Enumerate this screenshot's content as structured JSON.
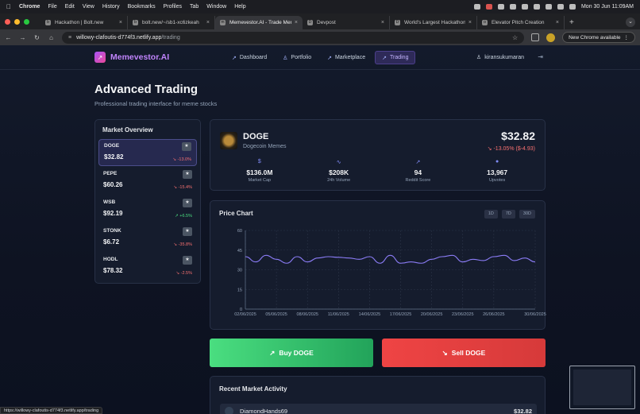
{
  "menubar": {
    "app": "Chrome",
    "items": [
      "File",
      "Edit",
      "View",
      "History",
      "Bookmarks",
      "Profiles",
      "Tab",
      "Window",
      "Help"
    ],
    "clock": "Mon 30 Jun  11:09AM"
  },
  "tabs": [
    {
      "title": "Hackathon | Bolt.new",
      "favicon": "b"
    },
    {
      "title": "bolt.new/~/sb1-xc6zkeah",
      "favicon": "b"
    },
    {
      "title": "Memevestor.AI - Trade Meme",
      "favicon": "m"
    },
    {
      "title": "Devpost",
      "favicon": "D"
    },
    {
      "title": "World's Largest Hackathon p",
      "favicon": "D"
    },
    {
      "title": "Elevator Pitch Creation",
      "favicon": "o"
    }
  ],
  "address": {
    "host": "willowy-clafoutis-d774f3.netlify.app",
    "path": "/trading",
    "update_label": "New Chrome available"
  },
  "app": {
    "logo": "Memevestor.AI",
    "nav": [
      {
        "label": "Dashboard",
        "icon": "trend-icon"
      },
      {
        "label": "Portfolio",
        "icon": "user-icon"
      },
      {
        "label": "Marketplace",
        "icon": "trend-icon"
      },
      {
        "label": "Trading",
        "icon": "trend-icon"
      }
    ],
    "active_nav": "Trading",
    "username": "kiransukumaran"
  },
  "page": {
    "title": "Advanced Trading",
    "subtitle": "Professional trading interface for meme stocks"
  },
  "market_overview": {
    "title": "Market Overview",
    "items": [
      {
        "symbol": "DOGE",
        "price": "$32.82",
        "change": "-13.0%",
        "direction": "down",
        "selected": true
      },
      {
        "symbol": "PEPE",
        "price": "$60.26",
        "change": "-15.4%",
        "direction": "down",
        "selected": false
      },
      {
        "symbol": "WSB",
        "price": "$92.19",
        "change": "+6.5%",
        "direction": "up",
        "selected": false
      },
      {
        "symbol": "STONK",
        "price": "$6.72",
        "change": "-35.8%",
        "direction": "down",
        "selected": false
      },
      {
        "symbol": "HODL",
        "price": "$78.32",
        "change": "-2.5%",
        "direction": "down",
        "selected": false
      }
    ]
  },
  "stock": {
    "symbol": "DOGE",
    "name": "Dogecoin Memes",
    "price": "$32.82",
    "change": "-13.05% ($-4.93)",
    "stats": [
      {
        "value": "$136.0M",
        "label": "Market Cap",
        "icon": "dollar-icon"
      },
      {
        "value": "$208K",
        "label": "24h Volume",
        "icon": "pulse-icon"
      },
      {
        "value": "94",
        "label": "Reddit Score",
        "icon": "trend-icon"
      },
      {
        "value": "13,967",
        "label": "Upvotes",
        "icon": "dot-icon"
      }
    ]
  },
  "chart": {
    "ranges": [
      "1D",
      "7D",
      "30D"
    ]
  },
  "chart_data": {
    "type": "line",
    "title": "Price Chart",
    "xlabel": "",
    "ylabel": "",
    "ylim": [
      0,
      60
    ],
    "yticks": [
      0,
      15,
      30,
      45,
      60
    ],
    "xticks": [
      "02/06/2025",
      "05/06/2025",
      "08/06/2025",
      "11/06/2025",
      "14/06/2025",
      "17/06/2025",
      "20/06/2025",
      "23/06/2025",
      "26/06/2025",
      "30/06/2025"
    ],
    "x": [
      "02/06/2025",
      "03/06/2025",
      "04/06/2025",
      "05/06/2025",
      "06/06/2025",
      "07/06/2025",
      "08/06/2025",
      "09/06/2025",
      "10/06/2025",
      "11/06/2025",
      "12/06/2025",
      "13/06/2025",
      "14/06/2025",
      "15/06/2025",
      "16/06/2025",
      "17/06/2025",
      "18/06/2025",
      "19/06/2025",
      "20/06/2025",
      "21/06/2025",
      "22/06/2025",
      "23/06/2025",
      "24/06/2025",
      "25/06/2025",
      "26/06/2025",
      "27/06/2025",
      "28/06/2025",
      "29/06/2025",
      "30/06/2025"
    ],
    "series": [
      {
        "values": [
          40,
          36,
          41,
          38,
          35,
          40,
          36,
          39,
          40,
          39.5,
          39,
          38,
          40,
          35,
          41,
          35,
          36,
          35,
          38,
          40,
          41,
          36,
          38,
          37,
          40,
          41,
          37,
          39,
          36
        ],
        "color": "#8b7cf6"
      }
    ],
    "grid": true
  },
  "actions": {
    "buy": "Buy DOGE",
    "sell": "Sell DOGE"
  },
  "recent": {
    "title": "Recent Market Activity",
    "rows": [
      {
        "user": "DiamondHands69",
        "amount": "$32.82"
      }
    ]
  },
  "statusbar": "https://willowy-clafoutis-d774f3.netlify.app/trading"
}
